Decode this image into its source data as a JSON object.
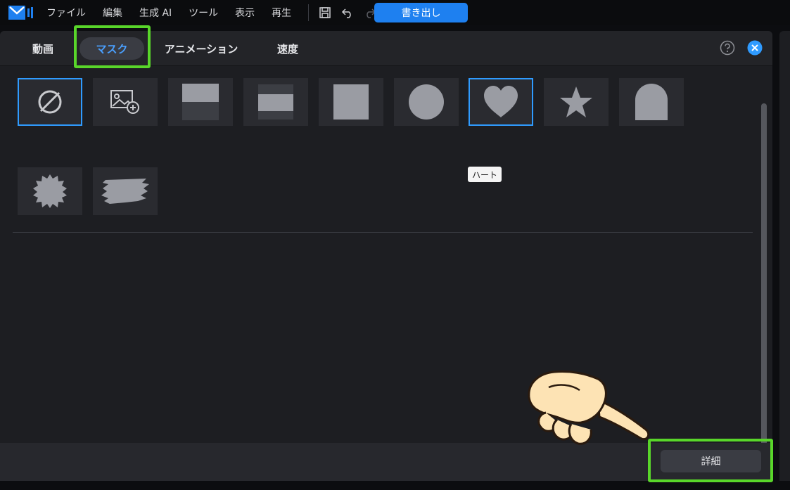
{
  "menubar": {
    "items": [
      "ファイル",
      "編集",
      "生成 AI",
      "ツール",
      "表示",
      "再生"
    ],
    "export_label": "書き出し",
    "icons": [
      "save-icon",
      "undo-icon",
      "redo-icon"
    ]
  },
  "tabs": [
    {
      "label": "動画",
      "active": false
    },
    {
      "label": "マスク",
      "active": true
    },
    {
      "label": "アニメーション",
      "active": false
    },
    {
      "label": "速度",
      "active": false
    }
  ],
  "masks": [
    {
      "icon": "none-icon",
      "selected": true
    },
    {
      "icon": "image-add-icon",
      "selected": false
    },
    {
      "icon": "top-half-icon",
      "selected": false
    },
    {
      "icon": "middle-band-icon",
      "selected": false
    },
    {
      "icon": "square-icon",
      "selected": false
    },
    {
      "icon": "circle-icon",
      "selected": false
    },
    {
      "icon": "heart-icon",
      "selected": true
    },
    {
      "icon": "star-icon",
      "selected": false
    },
    {
      "icon": "arch-icon",
      "selected": false
    },
    {
      "icon": "burst-icon",
      "selected": false
    },
    {
      "icon": "brush-stroke-icon",
      "selected": false
    }
  ],
  "tooltip": "ハート",
  "footer": {
    "detail_label": "詳細"
  },
  "colors": {
    "accent": "#2f9bff",
    "highlight": "#59d62a",
    "export": "#1e80f0",
    "shape": "#9a9ca3"
  }
}
